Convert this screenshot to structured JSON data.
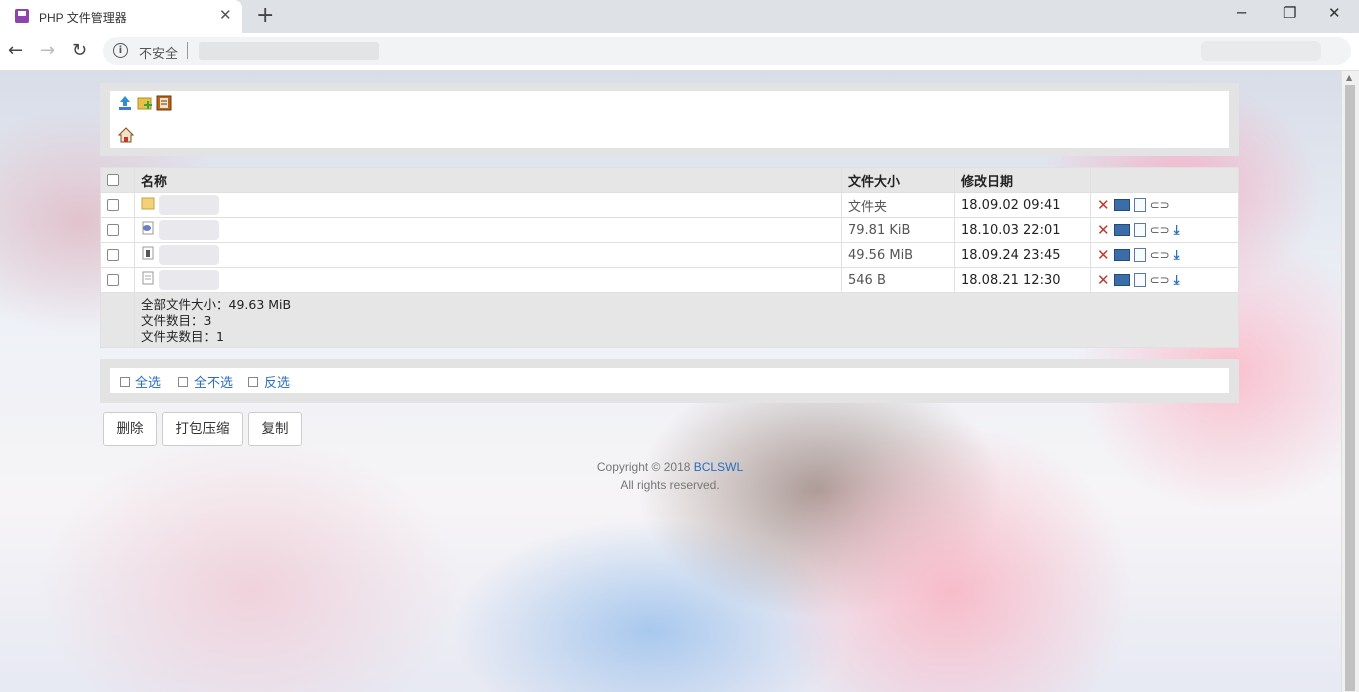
{
  "browser": {
    "tab_title": "PHP 文件管理器",
    "tab_close": "✕",
    "new_tab": "+",
    "security_label": "不安全",
    "window_controls": {
      "minimize": "─",
      "maximize": "❐",
      "close": "✕"
    },
    "nav": {
      "back": "←",
      "forward": "→",
      "reload": "↻"
    }
  },
  "toolbar": {
    "icons": [
      "upload-icon",
      "new-folder-icon",
      "new-file-icon"
    ],
    "home_icon": "home-icon"
  },
  "table": {
    "headers": {
      "name": "名称",
      "size": "文件大小",
      "modified": "修改日期"
    },
    "rows": [
      {
        "icon": "folder-icon",
        "size": "文件夹",
        "modified": "18.09.02 09:41",
        "download": false
      },
      {
        "icon": "php-file-icon",
        "size": "79.81 KiB",
        "modified": "18.10.03 22:01",
        "download": true
      },
      {
        "icon": "archive-file-icon",
        "size": "49.56 MiB",
        "modified": "18.09.24 23:45",
        "download": true
      },
      {
        "icon": "text-file-icon",
        "size": "546 B",
        "modified": "18.08.21 12:30",
        "download": true
      }
    ],
    "summary": {
      "total_size": "全部文件大小：49.63 MiB",
      "file_count": "文件数目：3",
      "folder_count": "文件夹数目：1"
    }
  },
  "selection": {
    "select_all": "全选",
    "unselect_all": "全不选",
    "invert": "反选"
  },
  "buttons": {
    "delete": "删除",
    "zip": "打包压缩",
    "copy": "复制"
  },
  "footer": {
    "copyright": "Copyright © 2018",
    "brand": "BCLSWL",
    "rights": "All rights reserved."
  },
  "colors": {
    "link": "#2a6ebb",
    "panel": "#e3e3e3",
    "delete": "#c0392b"
  }
}
